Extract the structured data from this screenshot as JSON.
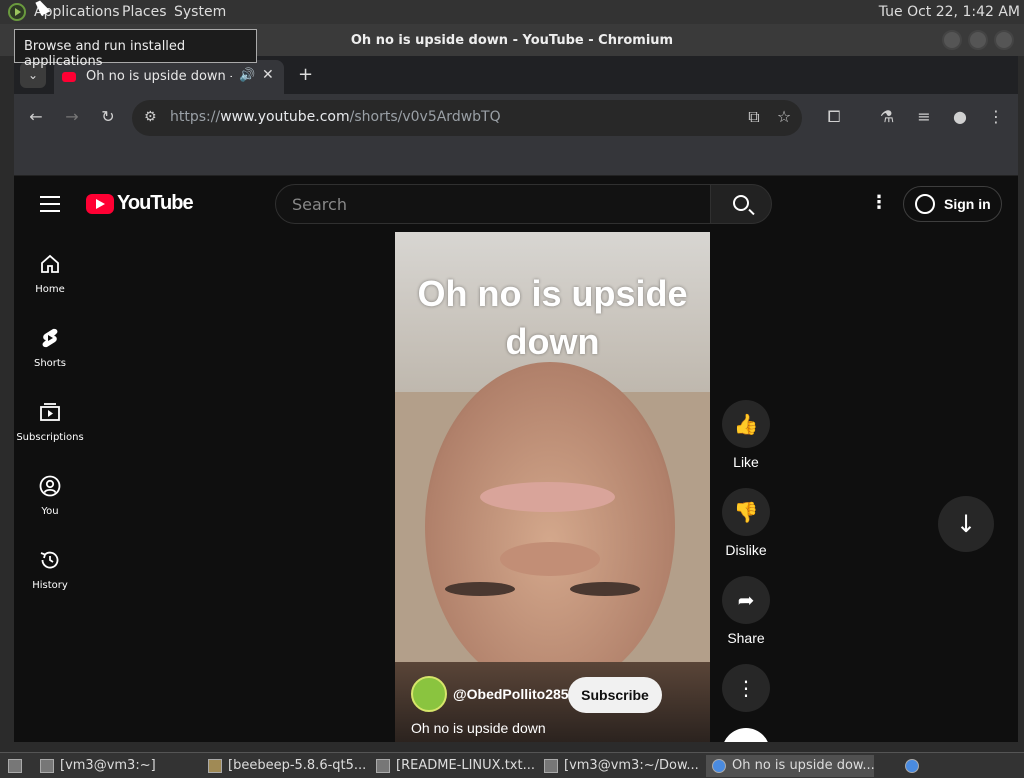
{
  "panel": {
    "menus": [
      "Applications",
      "Places",
      "System"
    ],
    "clock": "Tue Oct 22,  1:42 AM",
    "tooltip": "Browse and run installed applications"
  },
  "window": {
    "title": "Oh no is upside down - YouTube - Chromium"
  },
  "tab": {
    "title": "Oh no is upside down - YouTube",
    "audio_icon": "speaker-icon",
    "close": "✕",
    "new_tab": "+"
  },
  "toolbar": {
    "url_prefix": "https://",
    "url_host": "www.youtube.com",
    "url_path": "/shorts/v0v5ArdwbTQ"
  },
  "youtube": {
    "logo_text": "YouTube",
    "search_placeholder": "Search",
    "signin": "Sign in",
    "sidebar": [
      {
        "label": "Home",
        "icon": "home-icon"
      },
      {
        "label": "Shorts",
        "icon": "shorts-icon"
      },
      {
        "label": "Subscriptions",
        "icon": "subscriptions-icon"
      },
      {
        "label": "You",
        "icon": "you-icon"
      },
      {
        "label": "History",
        "icon": "history-icon"
      }
    ],
    "video": {
      "caption": "Oh no is upside down",
      "channel": "@ObedPollito285",
      "subscribe": "Subscribe",
      "title": "Oh no is upside down"
    },
    "actions": {
      "like": "Like",
      "dislike": "Dislike",
      "share": "Share"
    }
  },
  "taskbar": [
    {
      "label": "[vm3@vm3:~]",
      "active": false
    },
    {
      "label": "[beebeep-5.8.6-qt5...",
      "active": false
    },
    {
      "label": "[README-LINUX.txt...",
      "active": false
    },
    {
      "label": "[vm3@vm3:~/Dow...",
      "active": false
    },
    {
      "label": "Oh no is upside dow...",
      "active": true
    }
  ]
}
